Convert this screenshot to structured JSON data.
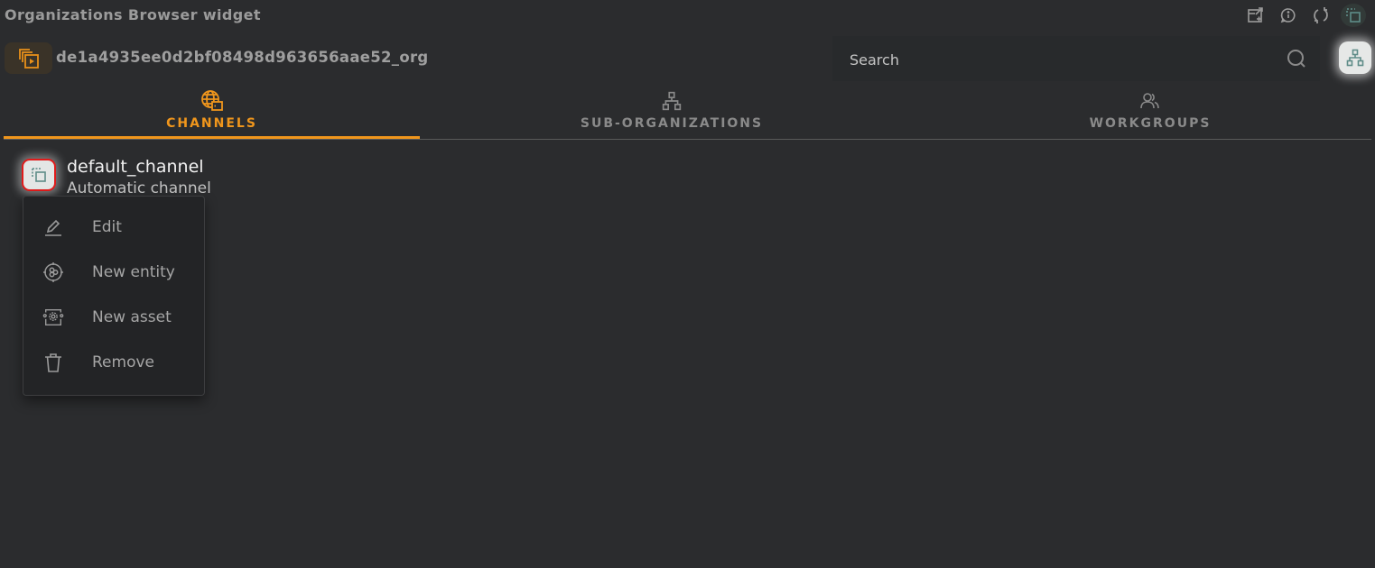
{
  "window": {
    "title": "Organizations Browser widget"
  },
  "top_icons": [
    {
      "name": "export-icon",
      "active": false
    },
    {
      "name": "info-icon",
      "active": false
    },
    {
      "name": "refresh-icon",
      "active": false
    },
    {
      "name": "select-area-icon",
      "active": true
    }
  ],
  "org": {
    "name": "de1a4935ee0d2bf08498d963656aae52_org",
    "icon": "channel-stack-icon"
  },
  "search": {
    "placeholder": "Search",
    "value": ""
  },
  "tabs": [
    {
      "label": "CHANNELS",
      "icon": "globe-channel-icon",
      "active": true
    },
    {
      "label": "SUB-ORGANIZATIONS",
      "icon": "hierarchy-icon",
      "active": false
    },
    {
      "label": "WORKGROUPS",
      "icon": "users-icon",
      "active": false
    }
  ],
  "channels": [
    {
      "name": "default_channel",
      "description": "Automatic channel"
    }
  ],
  "context_menu": {
    "items": [
      {
        "label": "Edit",
        "icon": "pencil-icon"
      },
      {
        "label": "New entity",
        "icon": "entity-icon"
      },
      {
        "label": "New asset",
        "icon": "asset-icon"
      },
      {
        "label": "Remove",
        "icon": "trash-icon"
      }
    ]
  },
  "colors": {
    "accent": "#f0961c",
    "background": "#2b2c2e",
    "highlight_border": "#e11b1b",
    "teal_icon": "#5e8c88"
  }
}
